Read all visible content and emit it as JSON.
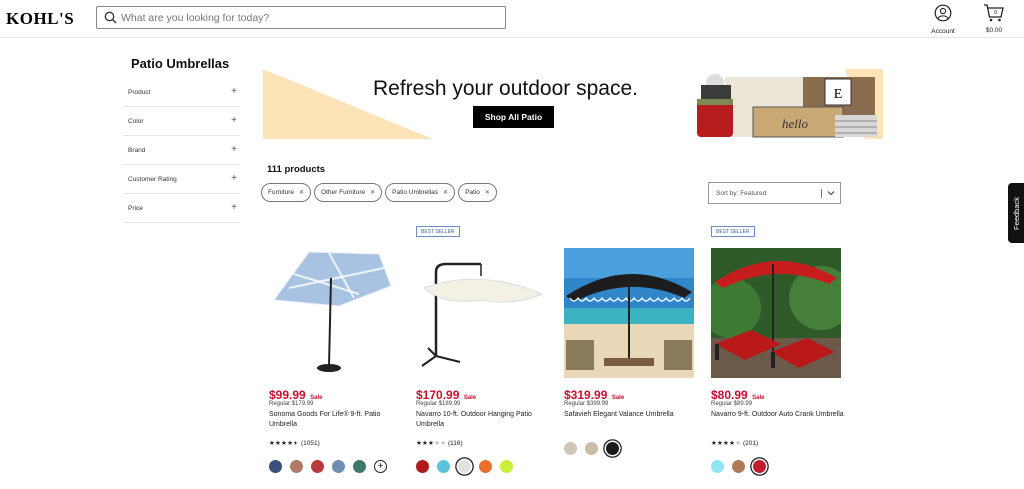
{
  "header": {
    "logo": "KOHL'S",
    "search_placeholder": "What are you looking for today?",
    "account_label": "Account",
    "cart_total": "$0.00",
    "cart_count": "0"
  },
  "sidebar": {
    "title": "Patio Umbrellas",
    "filters": [
      "Product",
      "Color",
      "Brand",
      "Customer Rating",
      "Price"
    ]
  },
  "banner": {
    "headline": "Refresh your outdoor space.",
    "button_label": "Shop All Patio",
    "accent_color": "#fde3b8"
  },
  "results": {
    "count_label": "111 products",
    "chips": [
      "Furniture",
      "Other Furniture",
      "Patio Umbrellas",
      "Patio"
    ],
    "sort_label": "Sort by: Featured"
  },
  "feedback_label": "Feedback",
  "products": [
    {
      "badge": "",
      "price": "$99.99",
      "sale_label": "Sale",
      "regular": "Regular $179.99",
      "name": "Sonoma Goods For Life® 9-ft. Patio Umbrella",
      "rating": 4.5,
      "stars": "★★★★★",
      "reviews": "(1051)",
      "swatches": [
        "#3b4f7c",
        "#b07a6b",
        "#b83a3a",
        "#6f8fb0",
        "#3e7a6a"
      ],
      "selected_swatch": -1,
      "more_swatches": true
    },
    {
      "badge": "BEST SELLER",
      "price": "$170.99",
      "sale_label": "Sale",
      "regular": "Regular $189.99",
      "name": "Navarro 10-ft. Outdoor Hanging Patio Umbrella",
      "rating": 3,
      "stars": "★★★★★",
      "reviews": "(116)",
      "swatches": [
        "#b01a1a",
        "#5bc4dc",
        "#e2e2e2",
        "#e87030",
        "#c8f03a"
      ],
      "selected_swatch": 2,
      "more_swatches": false
    },
    {
      "badge": "",
      "price": "$319.99",
      "sale_label": "Sale",
      "regular": "Regular $399.99",
      "name": "Safavieh Elegant Valance Umbrella",
      "rating": 0,
      "stars": "",
      "reviews": "",
      "swatches": [
        "#cfc6b8",
        "#c9bda6",
        "#1a1a1a"
      ],
      "selected_swatch": 2,
      "more_swatches": false
    },
    {
      "badge": "BEST SELLER",
      "price": "$80.99",
      "sale_label": "Sale",
      "regular": "Regular $89.99",
      "name": "Navarro 9-ft. Outdoor Auto Crank Umbrella",
      "rating": 4,
      "stars": "★★★★★",
      "reviews": "(201)",
      "swatches": [
        "#8fe6f2",
        "#b07a5a",
        "#c21d2e"
      ],
      "selected_swatch": 2,
      "more_swatches": false
    }
  ]
}
